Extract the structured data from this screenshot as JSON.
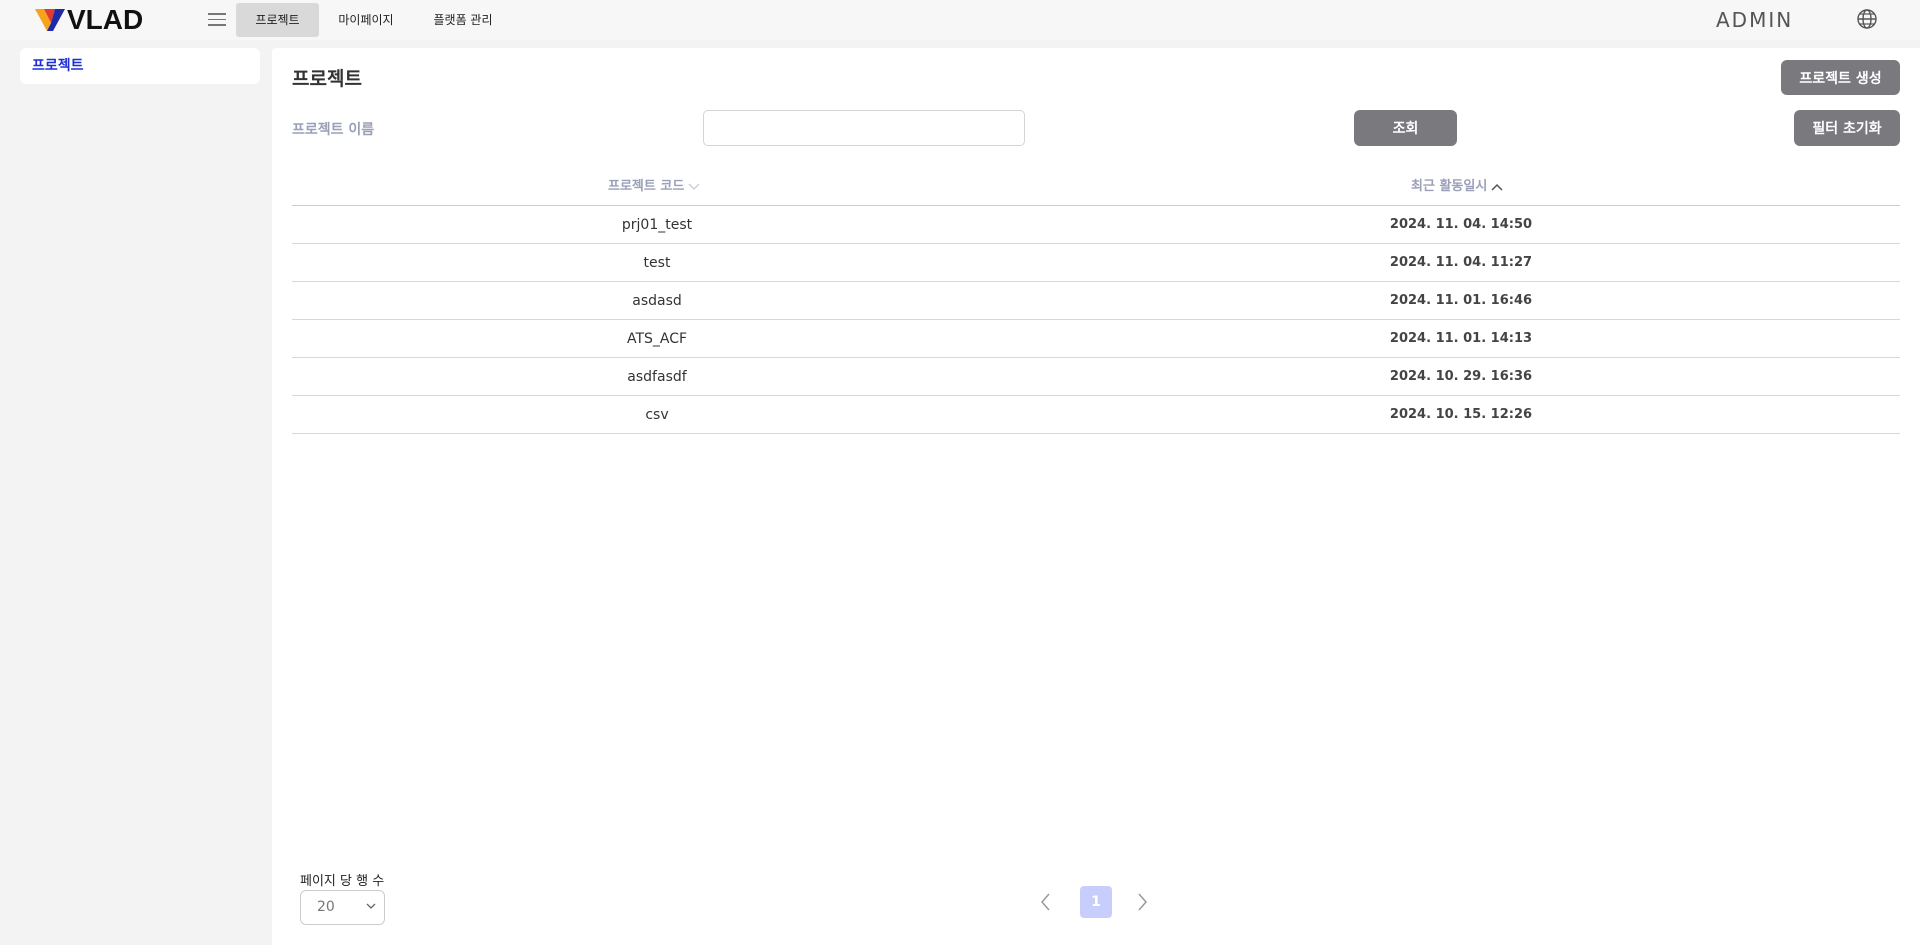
{
  "header": {
    "logo_text": "VLAD",
    "nav_tabs": [
      {
        "label": "프로젝트",
        "active": true
      },
      {
        "label": "마이페이지",
        "active": false
      },
      {
        "label": "플랫폼 관리",
        "active": false
      }
    ],
    "user_label": "ADMIN",
    "icons": {
      "menu": "hamburger-icon",
      "language": "globe-icon"
    }
  },
  "sidebar": {
    "items": [
      {
        "label": "프로젝트",
        "active": true
      }
    ]
  },
  "main": {
    "title": "프로젝트",
    "create_button": "프로젝트 생성",
    "filter": {
      "label": "프로젝트 이름",
      "value": "",
      "placeholder": "",
      "search_button": "조회",
      "reset_button": "필터 초기화"
    },
    "table": {
      "columns": [
        {
          "label": "프로젝트 코드",
          "sort": "none"
        },
        {
          "label": "최근 활동일시",
          "sort": "asc"
        }
      ],
      "rows": [
        {
          "code": "prj01_test",
          "last_activity": "2024. 11. 04. 14:50"
        },
        {
          "code": "test",
          "last_activity": "2024. 11. 04. 11:27"
        },
        {
          "code": "asdasd",
          "last_activity": "2024. 11. 01. 16:46"
        },
        {
          "code": "ATS_ACF",
          "last_activity": "2024. 11. 01. 14:13"
        },
        {
          "code": "asdfasdf",
          "last_activity": "2024. 10. 29. 16:36"
        },
        {
          "code": "csv",
          "last_activity": "2024. 10. 15. 12:26"
        }
      ]
    },
    "pagination": {
      "rows_per_page_label": "페이지 당 행 수",
      "rows_per_page": "20",
      "current_page": "1"
    }
  },
  "colors": {
    "accent": "#1b2fd6",
    "button": "#7a7a7e",
    "active_page": "#c7cefb",
    "header_text": "#9aa0b8"
  }
}
